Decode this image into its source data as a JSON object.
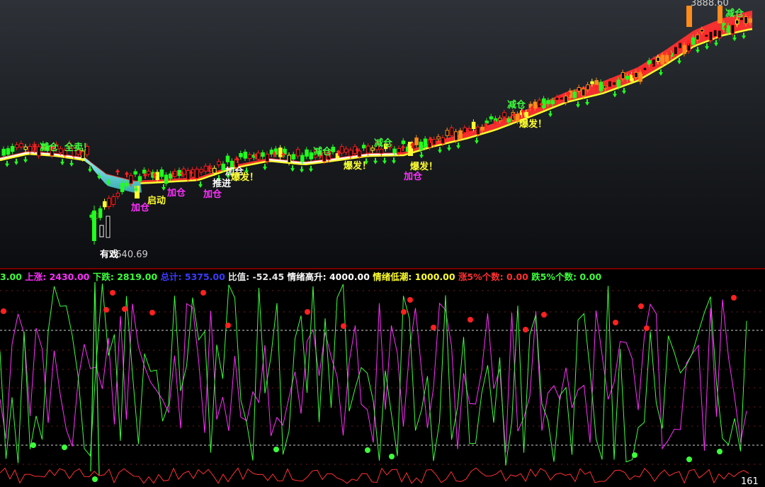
{
  "chart_data": [
    {
      "type": "candlestick",
      "price_labels": {
        "high": "3888.60",
        "low": "2640.69"
      },
      "signals": [
        {
          "text": "减仓",
          "kind": "reduce"
        },
        {
          "text": "全卖！",
          "kind": "sell-all"
        },
        {
          "text": "启动",
          "kind": "start"
        },
        {
          "text": "加仓",
          "kind": "add-1"
        },
        {
          "text": "加仓",
          "kind": "add-2"
        },
        {
          "text": "加仓",
          "kind": "add-3"
        },
        {
          "text": "推进",
          "kind": "push"
        },
        {
          "text": "加仓",
          "kind": "add-4"
        },
        {
          "text": "爆发！",
          "kind": "burst-1"
        },
        {
          "text": "减仓",
          "kind": "reduce-2"
        },
        {
          "text": "爆发！",
          "kind": "burst-2"
        },
        {
          "text": "减仓",
          "kind": "reduce-3"
        },
        {
          "text": "爆发！",
          "kind": "burst-3"
        },
        {
          "text": "加仓",
          "kind": "add-5"
        },
        {
          "text": "减仓",
          "kind": "reduce-4"
        },
        {
          "text": "爆发！",
          "kind": "burst-4"
        },
        {
          "text": "减仓",
          "kind": "reduce-5"
        },
        {
          "text": "有戏",
          "kind": "maybe"
        }
      ],
      "colors": {
        "up": "#ff2020",
        "down": "#20ff20",
        "band": "#ff3030",
        "band_edge": "#ffff30",
        "cyan_band": "#70e0e0"
      }
    },
    {
      "type": "line",
      "stats": [
        {
          "label": "3.00",
          "value": "",
          "color": "#3cff3c"
        },
        {
          "label": "上涨:",
          "value": "2430.00",
          "color": "#ff30ff"
        },
        {
          "label": "下跌:",
          "value": "2819.00",
          "color": "#3cff3c"
        },
        {
          "label": "总计:",
          "value": "5375.00",
          "color": "#3a3aff"
        },
        {
          "label": "比值:",
          "value": "-52.45",
          "color": "#e6e6e6"
        },
        {
          "label": "情绪高升:",
          "value": "4000.00",
          "color": "#ffffff"
        },
        {
          "label": "情绪低潮:",
          "value": "1000.00",
          "color": "#ffff30"
        },
        {
          "label": "涨5%个数:",
          "value": "0.00",
          "color": "#ff3030"
        },
        {
          "label": "跌5%个数:",
          "value": "0.00",
          "color": "#3cff3c"
        }
      ],
      "levels": {
        "high": 4000,
        "low": 1000
      },
      "corner_value": "161",
      "series": [
        {
          "color": "#ff30ff"
        },
        {
          "color": "#3cff3c"
        },
        {
          "color": "#ff3030"
        }
      ]
    }
  ]
}
